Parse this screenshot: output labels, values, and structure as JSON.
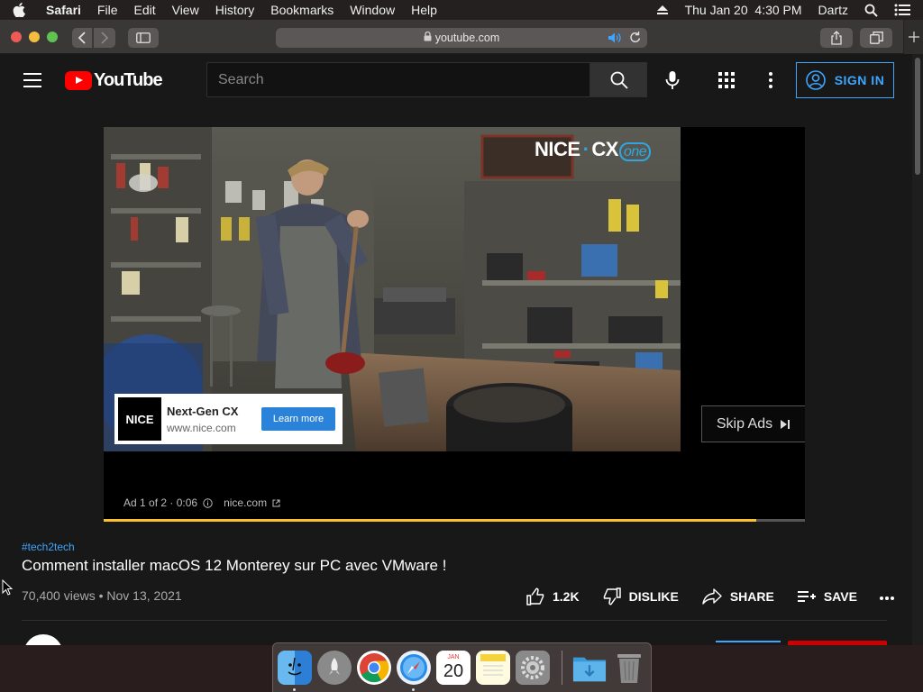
{
  "menubar": {
    "apple_icon": "apple-logo",
    "items": [
      "Safari",
      "File",
      "Edit",
      "View",
      "History",
      "Bookmarks",
      "Window",
      "Help"
    ],
    "datetime": "Thu Jan 20  4:30 PM",
    "user": "Dartz"
  },
  "browser": {
    "address": "youtube.com"
  },
  "youtube": {
    "logo_text": "YouTube",
    "search_placeholder": "Search",
    "sign_in": "SIGN IN"
  },
  "ad": {
    "brand_main": "NICE",
    "brand_cx": "CX",
    "brand_one": "one",
    "card_logo": "NICE",
    "card_title": "Next-Gen CX",
    "card_url": "www.nice.com",
    "learn_more": "Learn more",
    "skip": "Skip Ads",
    "info_counter": "Ad 1 of 2 · 0:06",
    "info_domain": "nice.com",
    "progress_fraction": 0.93
  },
  "video": {
    "hashtag": "#tech2tech",
    "title": "Comment installer macOS 12 Monterey sur PC avec VMware !",
    "meta": "70,400 views • Nov 13, 2021",
    "likes": "1.2K",
    "dislike": "DISLIKE",
    "share": "SHARE",
    "save": "SAVE"
  },
  "dock": {
    "calendar_month": "JAN",
    "calendar_day": "20",
    "apps": [
      "finder-icon",
      "launchpad-icon",
      "chrome-icon",
      "safari-icon",
      "calendar-icon",
      "notes-icon",
      "system-preferences-icon",
      "downloads-folder-icon",
      "trash-icon"
    ]
  },
  "colors": {
    "youtube_red": "#ff0000",
    "link_blue": "#3ea6ff",
    "ad_progress": "#fbc02d",
    "page_bg": "#181818"
  }
}
